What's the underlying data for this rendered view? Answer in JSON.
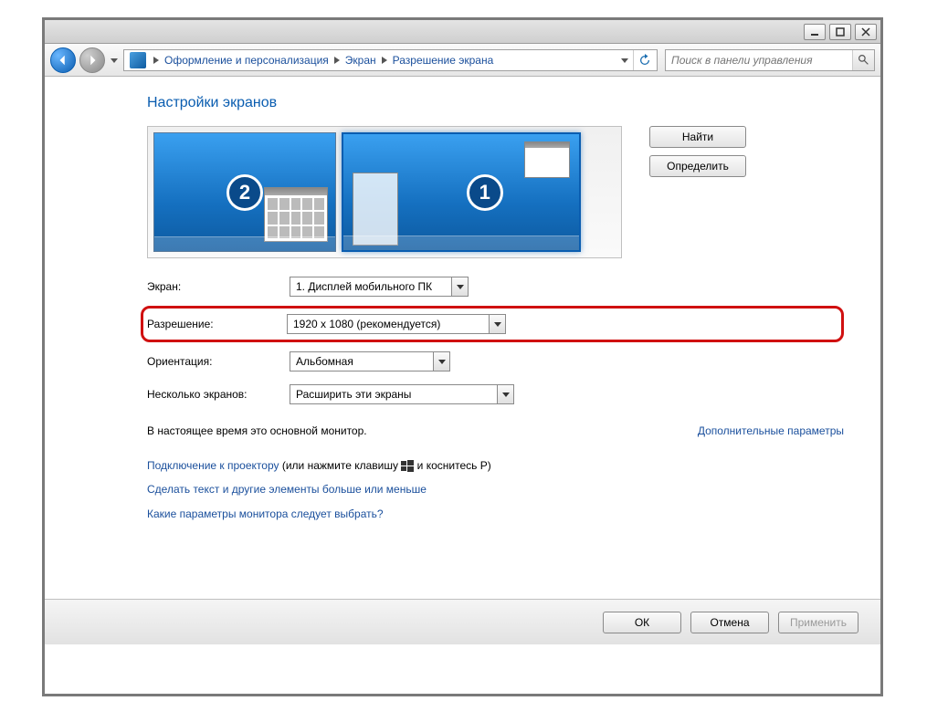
{
  "titlebar": {
    "min_tip": "Свернуть",
    "max_tip": "Развернуть",
    "close_tip": "Закрыть"
  },
  "breadcrumbs": {
    "item1": "Оформление и персонализация",
    "item2": "Экран",
    "item3": "Разрешение экрана"
  },
  "search": {
    "placeholder": "Поиск в панели управления"
  },
  "page": {
    "title": "Настройки экранов"
  },
  "monitors": {
    "num1": "1",
    "num2": "2"
  },
  "side": {
    "find": "Найти",
    "identify": "Определить"
  },
  "form": {
    "display_label": "Экран:",
    "display_value": "1. Дисплей мобильного ПК",
    "resolution_label": "Разрешение:",
    "resolution_value": "1920 x 1080 (рекомендуется)",
    "orientation_label": "Ориентация:",
    "orientation_value": "Альбомная",
    "multi_label": "Несколько экранов:",
    "multi_value": "Расширить эти экраны"
  },
  "status": {
    "main_monitor": "В настоящее время это основной монитор.",
    "advanced": "Дополнительные параметры"
  },
  "links": {
    "proj_a": "Подключение к проектору",
    "proj_b": " (или нажмите клавишу ",
    "proj_c": " и коснитесь P)",
    "larger": "Сделать текст и другие элементы больше или меньше",
    "which": "Какие параметры монитора следует выбрать?"
  },
  "footer": {
    "ok": "ОК",
    "cancel": "Отмена",
    "apply": "Применить"
  }
}
